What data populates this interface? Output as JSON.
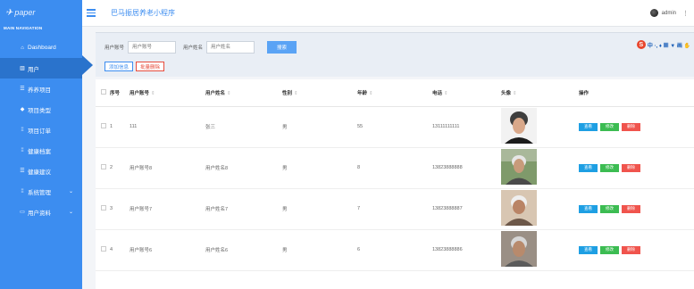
{
  "sidebar": {
    "logo": "paper",
    "nav_title": "MAIN NAVIGATION",
    "items": [
      {
        "label": "Dashboard",
        "icon": "home-icon"
      },
      {
        "label": "用户",
        "icon": "chart-icon"
      },
      {
        "label": "养养项目",
        "icon": "list-icon"
      },
      {
        "label": "项目类型",
        "icon": "tag-icon"
      },
      {
        "label": "项目订单",
        "icon": "grid-icon"
      },
      {
        "label": "健康档案",
        "icon": "grid-icon"
      },
      {
        "label": "健康建议",
        "icon": "list-icon"
      },
      {
        "label": "系统管理",
        "icon": "grid-icon"
      },
      {
        "label": "用户资料",
        "icon": "card-icon"
      }
    ]
  },
  "header": {
    "title": "巴马振居养老小程序",
    "user": "admin",
    "more": "⋮"
  },
  "search": {
    "account_label": "用户账号",
    "account_placeholder": "用户账号",
    "name_label": "用户姓名",
    "name_placeholder": "用户姓名",
    "search_button": "搜索",
    "add_button": "添加信息",
    "batch_delete_button": "批量删除"
  },
  "ime": {
    "letters": "中 ·, ♦ ▦ ▼ 画 ✋"
  },
  "table": {
    "headers": [
      "序号",
      "用户账号",
      "用户姓名",
      "性别",
      "年龄",
      "电话",
      "头像",
      "操作"
    ],
    "rows": [
      {
        "no": "1",
        "account": "111",
        "name": "张三",
        "gender": "男",
        "age": "55",
        "phone": "13111111111"
      },
      {
        "no": "2",
        "account": "用户账号8",
        "name": "用户姓名8",
        "gender": "男",
        "age": "8",
        "phone": "13823888888"
      },
      {
        "no": "3",
        "account": "用户账号7",
        "name": "用户姓名7",
        "gender": "男",
        "age": "7",
        "phone": "13823888887"
      },
      {
        "no": "4",
        "account": "用户账号6",
        "name": "用户姓名6",
        "gender": "男",
        "age": "6",
        "phone": "13823888886"
      }
    ],
    "actions": {
      "view": "查看",
      "edit": "修改",
      "delete": "删除"
    }
  },
  "colors": {
    "primary": "#3c8df0",
    "sidebar_active": "#2a73cc",
    "view": "#1e9fe3",
    "edit": "#3cbc52",
    "delete": "#f0544d"
  }
}
